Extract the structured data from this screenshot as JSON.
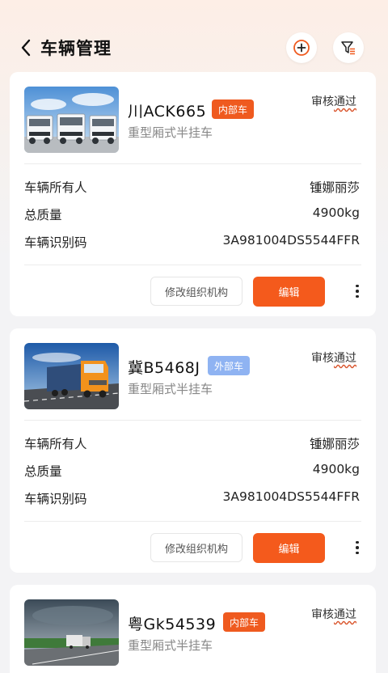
{
  "header": {
    "title": "车辆管理",
    "back_icon": "chevron-left-icon",
    "add_icon": "plus-circle-icon",
    "filter_icon": "filter-list-icon"
  },
  "labels": {
    "owner": "车辆所有人",
    "total_mass": "总质量",
    "vin": "车辆识别码",
    "modify_org": "修改组织机构",
    "edit": "编辑"
  },
  "colors": {
    "accent": "#f45a1c",
    "internal_tag": "#ef5a1f",
    "external_tag": "#8fb3f2"
  },
  "vehicles": [
    {
      "plate": "川ACK665",
      "tag": "内部车",
      "type": "重型厢式半挂车",
      "status": "审核通过",
      "owner": "锺娜丽莎",
      "total_mass": "4900kg",
      "vin": "3A981004DS5544FFR"
    },
    {
      "plate": "冀B5468J",
      "tag": "外部车",
      "type": "重型厢式半挂车",
      "status": "审核通过",
      "owner": "锺娜丽莎",
      "total_mass": "4900kg",
      "vin": "3A981004DS5544FFR"
    },
    {
      "plate": "粤Gk54539",
      "tag": "内部车",
      "type": "重型厢式半挂车",
      "status": "审核通过"
    }
  ]
}
